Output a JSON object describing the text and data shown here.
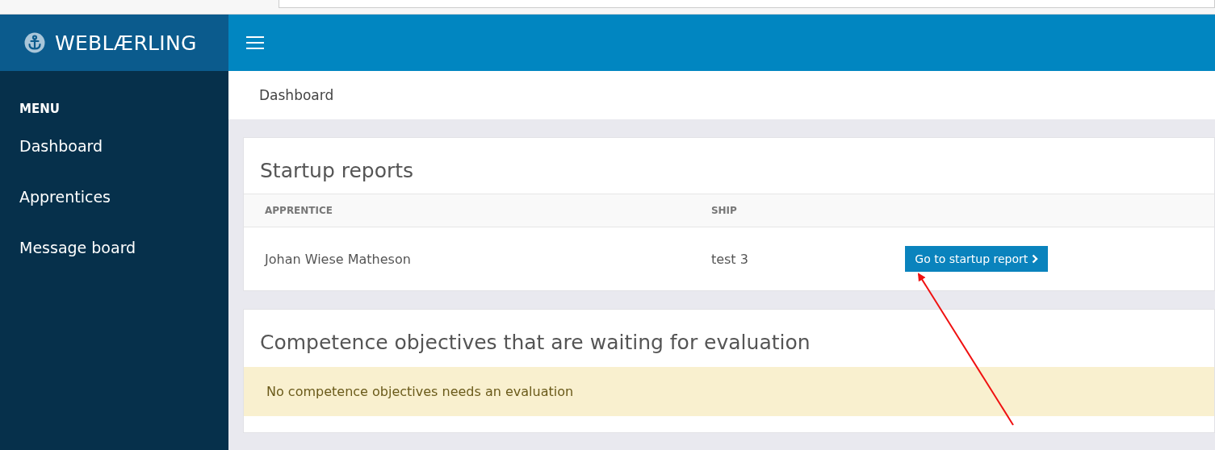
{
  "brand": {
    "name": "WEBLÆRLING"
  },
  "sidebar": {
    "heading": "MENU",
    "items": [
      {
        "label": "Dashboard"
      },
      {
        "label": "Apprentices"
      },
      {
        "label": "Message board"
      }
    ]
  },
  "breadcrumb": "Dashboard",
  "startup_reports": {
    "title": "Startup reports",
    "columns": [
      "APPRENTICE",
      "SHIP"
    ],
    "rows": [
      {
        "apprentice": "Johan Wiese Matheson",
        "ship": "test 3",
        "action": "Go to startup report"
      }
    ]
  },
  "competence": {
    "title": "Competence objectives that are waiting for evaluation",
    "notice": "No competence objectives needs an evaluation"
  }
}
